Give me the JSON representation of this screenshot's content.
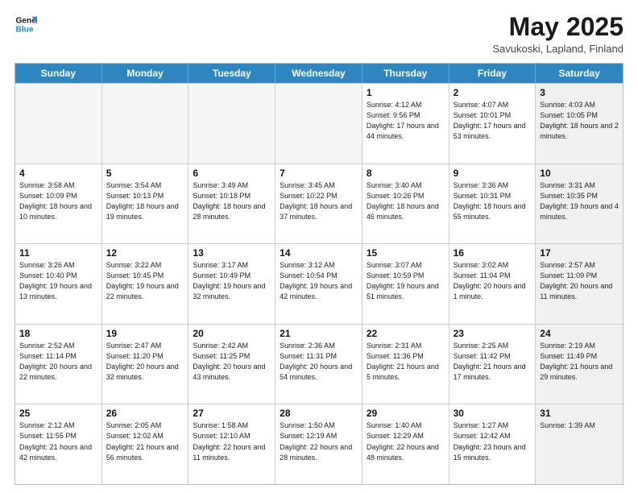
{
  "header": {
    "logo_line1": "General",
    "logo_line2": "Blue",
    "title": "May 2025",
    "subtitle": "Savukoski, Lapland, Finland"
  },
  "days_of_week": [
    "Sunday",
    "Monday",
    "Tuesday",
    "Wednesday",
    "Thursday",
    "Friday",
    "Saturday"
  ],
  "rows": [
    [
      {
        "day": "",
        "info": "",
        "empty": true
      },
      {
        "day": "",
        "info": "",
        "empty": true
      },
      {
        "day": "",
        "info": "",
        "empty": true
      },
      {
        "day": "",
        "info": "",
        "empty": true
      },
      {
        "day": "1",
        "info": "Sunrise: 4:12 AM\nSunset: 9:56 PM\nDaylight: 17 hours\nand 44 minutes.",
        "empty": false
      },
      {
        "day": "2",
        "info": "Sunrise: 4:07 AM\nSunset: 10:01 PM\nDaylight: 17 hours\nand 53 minutes.",
        "empty": false
      },
      {
        "day": "3",
        "info": "Sunrise: 4:03 AM\nSunset: 10:05 PM\nDaylight: 18 hours\nand 2 minutes.",
        "empty": false,
        "shaded": true
      }
    ],
    [
      {
        "day": "4",
        "info": "Sunrise: 3:58 AM\nSunset: 10:09 PM\nDaylight: 18 hours\nand 10 minutes.",
        "empty": false
      },
      {
        "day": "5",
        "info": "Sunrise: 3:54 AM\nSunset: 10:13 PM\nDaylight: 18 hours\nand 19 minutes.",
        "empty": false
      },
      {
        "day": "6",
        "info": "Sunrise: 3:49 AM\nSunset: 10:18 PM\nDaylight: 18 hours\nand 28 minutes.",
        "empty": false
      },
      {
        "day": "7",
        "info": "Sunrise: 3:45 AM\nSunset: 10:22 PM\nDaylight: 18 hours\nand 37 minutes.",
        "empty": false
      },
      {
        "day": "8",
        "info": "Sunrise: 3:40 AM\nSunset: 10:26 PM\nDaylight: 18 hours\nand 46 minutes.",
        "empty": false
      },
      {
        "day": "9",
        "info": "Sunrise: 3:36 AM\nSunset: 10:31 PM\nDaylight: 18 hours\nand 55 minutes.",
        "empty": false
      },
      {
        "day": "10",
        "info": "Sunrise: 3:31 AM\nSunset: 10:35 PM\nDaylight: 19 hours\nand 4 minutes.",
        "empty": false,
        "shaded": true
      }
    ],
    [
      {
        "day": "11",
        "info": "Sunrise: 3:26 AM\nSunset: 10:40 PM\nDaylight: 19 hours\nand 13 minutes.",
        "empty": false
      },
      {
        "day": "12",
        "info": "Sunrise: 3:22 AM\nSunset: 10:45 PM\nDaylight: 19 hours\nand 22 minutes.",
        "empty": false
      },
      {
        "day": "13",
        "info": "Sunrise: 3:17 AM\nSunset: 10:49 PM\nDaylight: 19 hours\nand 32 minutes.",
        "empty": false
      },
      {
        "day": "14",
        "info": "Sunrise: 3:12 AM\nSunset: 10:54 PM\nDaylight: 19 hours\nand 42 minutes.",
        "empty": false
      },
      {
        "day": "15",
        "info": "Sunrise: 3:07 AM\nSunset: 10:59 PM\nDaylight: 19 hours\nand 51 minutes.",
        "empty": false
      },
      {
        "day": "16",
        "info": "Sunrise: 3:02 AM\nSunset: 11:04 PM\nDaylight: 20 hours\nand 1 minute.",
        "empty": false
      },
      {
        "day": "17",
        "info": "Sunrise: 2:57 AM\nSunset: 11:09 PM\nDaylight: 20 hours\nand 11 minutes.",
        "empty": false,
        "shaded": true
      }
    ],
    [
      {
        "day": "18",
        "info": "Sunrise: 2:52 AM\nSunset: 11:14 PM\nDaylight: 20 hours\nand 22 minutes.",
        "empty": false
      },
      {
        "day": "19",
        "info": "Sunrise: 2:47 AM\nSunset: 11:20 PM\nDaylight: 20 hours\nand 32 minutes.",
        "empty": false
      },
      {
        "day": "20",
        "info": "Sunrise: 2:42 AM\nSunset: 11:25 PM\nDaylight: 20 hours\nand 43 minutes.",
        "empty": false
      },
      {
        "day": "21",
        "info": "Sunrise: 2:36 AM\nSunset: 11:31 PM\nDaylight: 20 hours\nand 54 minutes.",
        "empty": false
      },
      {
        "day": "22",
        "info": "Sunrise: 2:31 AM\nSunset: 11:36 PM\nDaylight: 21 hours\nand 5 minutes.",
        "empty": false
      },
      {
        "day": "23",
        "info": "Sunrise: 2:25 AM\nSunset: 11:42 PM\nDaylight: 21 hours\nand 17 minutes.",
        "empty": false
      },
      {
        "day": "24",
        "info": "Sunrise: 2:19 AM\nSunset: 11:49 PM\nDaylight: 21 hours\nand 29 minutes.",
        "empty": false,
        "shaded": true
      }
    ],
    [
      {
        "day": "25",
        "info": "Sunrise: 2:12 AM\nSunset: 11:55 PM\nDaylight: 21 hours\nand 42 minutes.",
        "empty": false
      },
      {
        "day": "26",
        "info": "Sunrise: 2:05 AM\nSunset: 12:02 AM\nDaylight: 21 hours\nand 56 minutes.",
        "empty": false
      },
      {
        "day": "27",
        "info": "Sunrise: 1:58 AM\nSunset: 12:10 AM\nDaylight: 22 hours\nand 11 minutes.",
        "empty": false
      },
      {
        "day": "28",
        "info": "Sunrise: 1:50 AM\nSunset: 12:19 AM\nDaylight: 22 hours\nand 28 minutes.",
        "empty": false
      },
      {
        "day": "29",
        "info": "Sunrise: 1:40 AM\nSunset: 12:29 AM\nDaylight: 22 hours\nand 48 minutes.",
        "empty": false
      },
      {
        "day": "30",
        "info": "Sunrise: 1:27 AM\nSunset: 12:42 AM\nDaylight: 23 hours\nand 15 minutes.",
        "empty": false
      },
      {
        "day": "31",
        "info": "Sunrise: 1:39 AM",
        "empty": false,
        "shaded": true
      }
    ]
  ]
}
